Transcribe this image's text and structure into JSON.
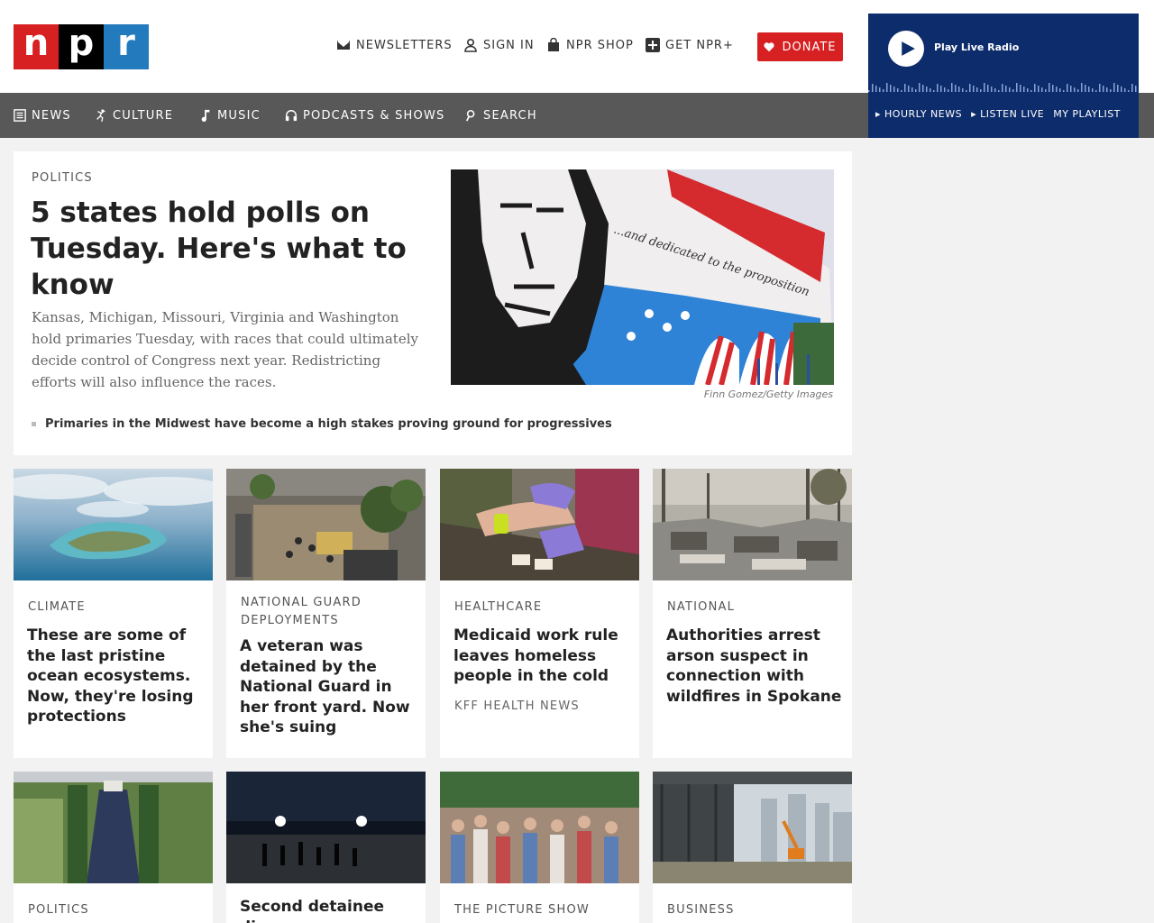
{
  "brand": {
    "logo_letters": [
      "n",
      "p",
      "r"
    ],
    "colors": {
      "red": "#d62021",
      "black": "#000000",
      "blue": "#237bbd",
      "player_bg": "#0d2c6b",
      "nav_bg": "#585858"
    }
  },
  "utility_links": {
    "newsletters": "NEWSLETTERS",
    "sign_in": "SIGN IN",
    "shop": "NPR SHOP",
    "get_npr_plus": "GET NPR+",
    "donate": "DONATE"
  },
  "nav": {
    "news": "NEWS",
    "culture": "CULTURE",
    "music": "MUSIC",
    "podcasts": "PODCASTS & SHOWS",
    "search": "SEARCH"
  },
  "player": {
    "play_label": "Play Live Radio",
    "hourly_news": "HOURLY NEWS",
    "listen_live": "LISTEN LIVE",
    "my_playlist": "MY PLAYLIST"
  },
  "lead": {
    "slug": "POLITICS",
    "title": "5 states hold polls on Tuesday. Here's what to know",
    "teaser": "Kansas, Michigan, Missouri, Virginia and Washington hold primaries Tuesday, with races that could ultimately decide control of Congress next year. Redistricting efforts will also influence the races.",
    "image_credit": "Finn Gomez/Getty Images",
    "related": "Primaries in the Midwest have become a high stakes proving ground for progressives"
  },
  "cards_row1": [
    {
      "slug": "CLIMATE",
      "headline": "These are some of the last pristine ocean ecosystems. Now, they're losing protections",
      "byline": ""
    },
    {
      "slug": "NATIONAL GUARD DEPLOYMENTS",
      "headline": "A veteran was detained by the National Guard in her front yard. Now she's suing",
      "byline": ""
    },
    {
      "slug": "HEALTHCARE",
      "headline": "Medicaid work rule leaves homeless people in the cold",
      "byline": "KFF HEALTH NEWS"
    },
    {
      "slug": "NATIONAL",
      "headline": "Authorities arrest arson suspect in connection with wildfires in Spokane",
      "byline": ""
    }
  ],
  "cards_row2": [
    {
      "slug": "POLITICS",
      "headline": ""
    },
    {
      "slug": "",
      "headline": "Second detainee dies"
    },
    {
      "slug": "THE PICTURE SHOW",
      "headline": ""
    },
    {
      "slug": "BUSINESS",
      "headline": ""
    }
  ]
}
